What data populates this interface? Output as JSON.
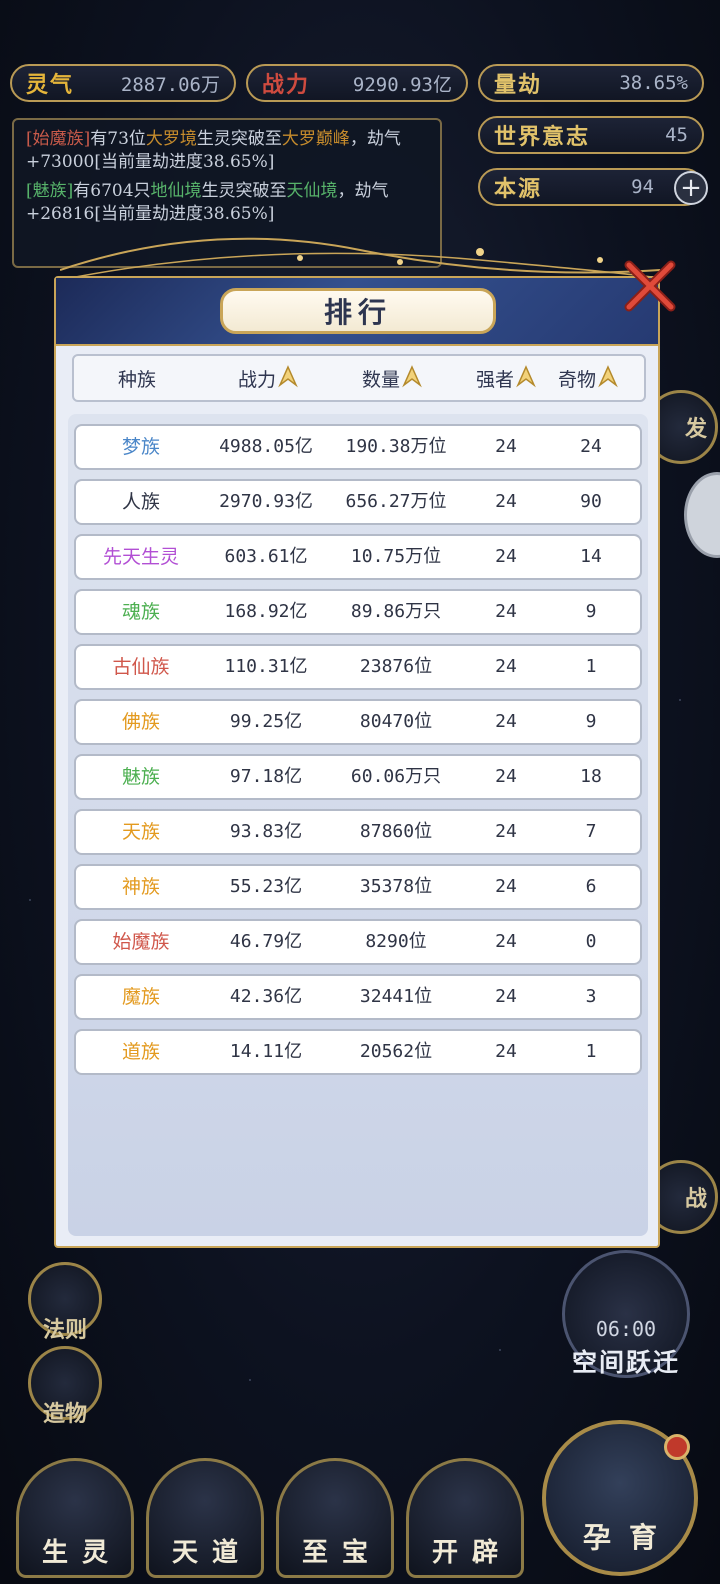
{
  "top_stats": {
    "lingqi": {
      "label": "灵气",
      "value": "2887.06万",
      "color": "#e5b53a"
    },
    "zhanli": {
      "label": "战力",
      "value": "9290.93亿",
      "color": "#cf4b3f"
    },
    "liangjie": {
      "label": "量劫",
      "value": "38.65%",
      "color": "#e1c26a"
    },
    "shijie_yizhi": {
      "label": "世界意志",
      "value": "45",
      "color": "#e1c26a"
    },
    "benyuan": {
      "label": "本源",
      "value": "94",
      "color": "#e1c26a"
    },
    "plus_label": "+"
  },
  "log": {
    "line1": {
      "race": "[始魔族]",
      "pre": "有73位",
      "realm": "大罗境",
      "mid": "生灵突破至",
      "target": "大罗巅峰",
      "post": "，劫气+73000[当前量劫进度38.65%]"
    },
    "line2": {
      "race": "[魅族]",
      "pre": "有6704只",
      "realm": "地仙境",
      "mid": "生灵突破至",
      "target": "天仙境",
      "post": "，劫气+26816[当前量劫进度38.65%]"
    }
  },
  "modal": {
    "title": "排行",
    "headers": {
      "race": "种族",
      "power": "战力",
      "count": "数量",
      "strong": "强者",
      "items": "奇物"
    },
    "rows": [
      {
        "race": "梦族",
        "color": "#4a86c8",
        "power": "4988.05亿",
        "count": "190.38万位",
        "strong": "24",
        "items": "24"
      },
      {
        "race": "人族",
        "color": "#2f3445",
        "power": "2970.93亿",
        "count": "656.27万位",
        "strong": "24",
        "items": "90"
      },
      {
        "race": "先天生灵",
        "color": "#b24fd4",
        "power": "603.61亿",
        "count": "10.75万位",
        "strong": "24",
        "items": "14"
      },
      {
        "race": "魂族",
        "color": "#4caf50",
        "power": "168.92亿",
        "count": "89.86万只",
        "strong": "24",
        "items": "9"
      },
      {
        "race": "古仙族",
        "color": "#d0574b",
        "power": "110.31亿",
        "count": "23876位",
        "strong": "24",
        "items": "1"
      },
      {
        "race": "佛族",
        "color": "#e39a1f",
        "power": "99.25亿",
        "count": "80470位",
        "strong": "24",
        "items": "9"
      },
      {
        "race": "魅族",
        "color": "#4caf50",
        "power": "97.18亿",
        "count": "60.06万只",
        "strong": "24",
        "items": "18"
      },
      {
        "race": "天族",
        "color": "#e39a1f",
        "power": "93.83亿",
        "count": "87860位",
        "strong": "24",
        "items": "7"
      },
      {
        "race": "神族",
        "color": "#e39a1f",
        "power": "55.23亿",
        "count": "35378位",
        "strong": "24",
        "items": "6"
      },
      {
        "race": "始魔族",
        "color": "#d0574b",
        "power": "46.79亿",
        "count": "8290位",
        "strong": "24",
        "items": "0"
      },
      {
        "race": "魔族",
        "color": "#e39a1f",
        "power": "42.36亿",
        "count": "32441位",
        "strong": "24",
        "items": "3"
      },
      {
        "race": "道族",
        "color": "#e39a1f",
        "power": "14.11亿",
        "count": "20562位",
        "strong": "24",
        "items": "1"
      }
    ]
  },
  "side_left": {
    "faze": "法则",
    "zaowu": "造物"
  },
  "space_jump": {
    "time": "06:00",
    "label": "空间跃迁"
  },
  "bottom_nav": [
    {
      "label": "生灵"
    },
    {
      "label": "天道"
    },
    {
      "label": "至宝"
    },
    {
      "label": "开辟"
    }
  ],
  "yunyu": {
    "label": "孕育"
  },
  "right_peek": {
    "fa": "发",
    "zhan": "战"
  }
}
